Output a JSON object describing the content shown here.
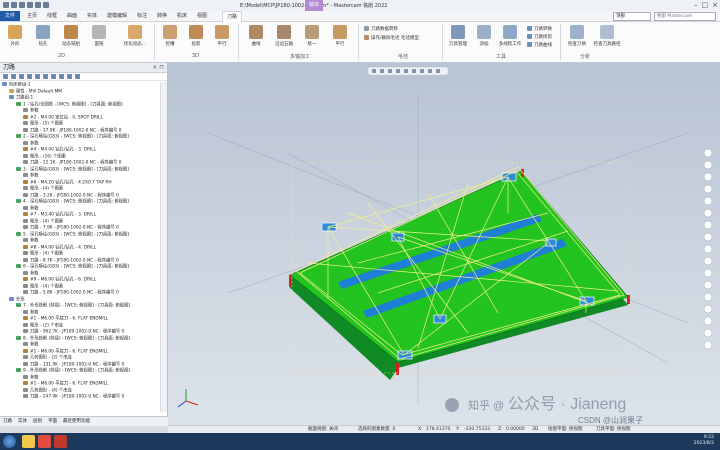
{
  "app": {
    "title": "E:\\Model\\MCP\\JP180-1002-0.mcam* - Mastercam 铣削 2022",
    "context_tab": "铣床"
  },
  "tabs": [
    "文件",
    "主页",
    "线框",
    "曲面",
    "实体",
    "建模编辑",
    "标注",
    "转换",
    "机床",
    "视图",
    "刀路"
  ],
  "ribbon": {
    "buttons_2d": [
      "外形",
      "钻孔",
      "动态铣削",
      "面铣"
    ],
    "more_2d": "优化动态...",
    "buttons_3d": [
      "挖槽",
      "投影",
      "平行"
    ],
    "buttons_multi": [
      "曲线",
      "沿边五轴",
      "统一",
      "平行"
    ],
    "group_labels": [
      "2D",
      "3D",
      "多轴加工",
      "工具",
      "分析"
    ],
    "utility": [
      "刀路数据转移",
      "操作/删除毛坯 毛坯模型",
      "毛坯模型"
    ],
    "tools": [
      "刀具管理",
      "添加",
      "多线程工作",
      "刀路转换",
      "刀路修剪",
      "刀路曲线",
      "刀路模拟"
    ],
    "analysis": [
      "检查刀柄",
      "检查刀具路径"
    ],
    "view_selector": "顶部",
    "search_placeholder": "搜索 Mastercam"
  },
  "left_panel": {
    "title": "刀路",
    "tree": [
      {
        "indent": 0,
        "text": "机床群组-1",
        "c": "#6a8bc4"
      },
      {
        "indent": 1,
        "text": "属性 - Mill Default MM",
        "c": "#c7a34a"
      },
      {
        "indent": 1,
        "text": "刀路组-1",
        "c": "#6a8bc4"
      },
      {
        "indent": 2,
        "text": "1 - 钻孔/全圆铣 - [WCS: 俯视图] - [刀具面: 俯视图]",
        "c": "#4aa35a"
      },
      {
        "indent": 3,
        "text": "参数",
        "c": "#8c8c8c"
      },
      {
        "indent": 3,
        "text": "#2 - M4.00 定位钻 - 0. SPOT DRILL",
        "c": "#b1813f"
      },
      {
        "indent": 3,
        "text": "图形 - (5) 个图素",
        "c": "#8c8c8c"
      },
      {
        "indent": 3,
        "text": "刀路 - 17.9K - JP180-1002-0.NC - 程序编号 0",
        "c": "#8c8c8c"
      },
      {
        "indent": 2,
        "text": "2 - 深孔啄钻(G83) - [WCS: 俯视图] - [刀具面: 俯视图]",
        "c": "#4aa35a"
      },
      {
        "indent": 3,
        "text": "参数",
        "c": "#8c8c8c"
      },
      {
        "indent": 3,
        "text": "#4 - M4.00 钻孔/钻孔 - 3. DRILL",
        "c": "#b1813f"
      },
      {
        "indent": 3,
        "text": "图形 - (16) 个图素",
        "c": "#8c8c8c"
      },
      {
        "indent": 3,
        "text": "刀路 - 12.1K - JP180-1002-0.NC - 程序编号 0",
        "c": "#8c8c8c"
      },
      {
        "indent": 2,
        "text": "3 - 深孔啄钻(G83) - [WCS: 俯视图] - [刀具面: 俯视图]",
        "c": "#4aa35a"
      },
      {
        "indent": 3,
        "text": "参数",
        "c": "#8c8c8c"
      },
      {
        "indent": 3,
        "text": "#6 - M4.20 钻孔/钻孔 - 4.2X0.7 TAP RH",
        "c": "#b1813f"
      },
      {
        "indent": 3,
        "text": "图形 - (4) 个图素",
        "c": "#8c8c8c"
      },
      {
        "indent": 3,
        "text": "刀路 - 3.2K - JP180-1002-0.NC - 程序编号 0",
        "c": "#8c8c8c"
      },
      {
        "indent": 2,
        "text": "4 - 深孔啄钻(G83) - [WCS: 俯视图] - [刀具面: 俯视图]",
        "c": "#4aa35a"
      },
      {
        "indent": 3,
        "text": "参数",
        "c": "#8c8c8c"
      },
      {
        "indent": 3,
        "text": "#7 - M3.40 钻孔/钻孔 - 3. DRILL",
        "c": "#b1813f"
      },
      {
        "indent": 3,
        "text": "图形 - (4) 个图素",
        "c": "#8c8c8c"
      },
      {
        "indent": 3,
        "text": "刀路 - 7.9K - JP180-1002-0.NC - 程序编号 0",
        "c": "#8c8c8c"
      },
      {
        "indent": 2,
        "text": "5 - 深孔啄钻(G83) - [WCS: 俯视图] - [刀具面: 俯视图]",
        "c": "#4aa35a"
      },
      {
        "indent": 3,
        "text": "参数",
        "c": "#8c8c8c"
      },
      {
        "indent": 3,
        "text": "#8 - M4.00 钻孔/钻孔 - 4. DRILL",
        "c": "#b1813f"
      },
      {
        "indent": 3,
        "text": "图形 - (4) 个图素",
        "c": "#8c8c8c"
      },
      {
        "indent": 3,
        "text": "刀路 - 8.7K - JP180-1002-0.NC - 程序编号 0",
        "c": "#8c8c8c"
      },
      {
        "indent": 2,
        "text": "6 - 深孔啄钻(G83) - [WCS: 俯视图] - [刀具面: 俯视图]",
        "c": "#4aa35a"
      },
      {
        "indent": 3,
        "text": "参数",
        "c": "#8c8c8c"
      },
      {
        "indent": 3,
        "text": "#9 - M6.00 钻孔/钻孔 - 6. DRILL",
        "c": "#b1813f"
      },
      {
        "indent": 3,
        "text": "图形 - (4) 个图素",
        "c": "#8c8c8c"
      },
      {
        "indent": 3,
        "text": "刀路 - 5.8K - JP180-1002-0.NC - 程序编号 0",
        "c": "#8c8c8c"
      },
      {
        "indent": 1,
        "text": "外形",
        "c": "#6a8bc4"
      },
      {
        "indent": 2,
        "text": "7 - 外形铣削 (斜插) - [WCS: 俯视图] - [刀具面: 俯视图]",
        "c": "#4aa35a"
      },
      {
        "indent": 3,
        "text": "参数",
        "c": "#8c8c8c"
      },
      {
        "indent": 3,
        "text": "#1 - M6.00 平底刀 - 6. FLAT ENDMILL",
        "c": "#b1813f"
      },
      {
        "indent": 3,
        "text": "图形 - (2) 个串连",
        "c": "#8c8c8c"
      },
      {
        "indent": 3,
        "text": "刀路 - 962.7K - JP180-1002-0.NC - 程序编号 0",
        "c": "#8c8c8c"
      },
      {
        "indent": 2,
        "text": "8 - 外形铣削 (斜插) - [WCS: 俯视图] - [刀具面: 俯视图]",
        "c": "#4aa35a"
      },
      {
        "indent": 3,
        "text": "参数",
        "c": "#8c8c8c"
      },
      {
        "indent": 3,
        "text": "#1 - M6.00 平底刀 - 6. FLAT ENDMILL",
        "c": "#b1813f"
      },
      {
        "indent": 3,
        "text": "几何图形 - (2) 个串连",
        "c": "#8c8c8c"
      },
      {
        "indent": 3,
        "text": "刀路 - 131.0K - JP180-1002-0.NC - 程序编号 0",
        "c": "#8c8c8c"
      },
      {
        "indent": 2,
        "text": "9 - 外形铣削 (斜插) - [WCS: 俯视图] - [刀具面: 俯视图]",
        "c": "#4aa35a"
      },
      {
        "indent": 3,
        "text": "参数",
        "c": "#8c8c8c"
      },
      {
        "indent": 3,
        "text": "#1 - M6.00 平底刀 - 6. FLAT ENDMILL",
        "c": "#b1813f"
      },
      {
        "indent": 3,
        "text": "几何图形 - (4) 个串连",
        "c": "#8c8c8c"
      },
      {
        "indent": 3,
        "text": "刀路 - 247.0K - JP180-1002-0.NC - 程序编号 0",
        "c": "#8c8c8c"
      }
    ]
  },
  "bottom_tabs": [
    "刀路",
    "实体",
    "层别",
    "平面",
    "最近使用功能"
  ],
  "statusbar": {
    "section": "截面视图: 关闭",
    "selected": "选择的图素数量: 0",
    "x_label": "X:",
    "x": "178.41370",
    "y_label": "Y:",
    "y": "-330.75333",
    "z_label": "Z:",
    "z": "0.00000",
    "mode": "3D",
    "plane": "绘图平面: 俯视图",
    "tool_plane": "刀具平面: 俯视图"
  },
  "taskbar": {
    "time": "9:22",
    "date": "2023/8/2"
  },
  "watermark": {
    "zhihu": "知乎 @",
    "line1": "公众号 · Jianeng",
    "line2": "CSDN @山涧果子"
  },
  "colors": {
    "part_green": "#23c41f",
    "slot_blue": "#1f7fd6",
    "toolpath_yellow": "#f2f08a",
    "viewport_top": "#b8c3d3",
    "viewport_bottom": "#dde3ea"
  }
}
